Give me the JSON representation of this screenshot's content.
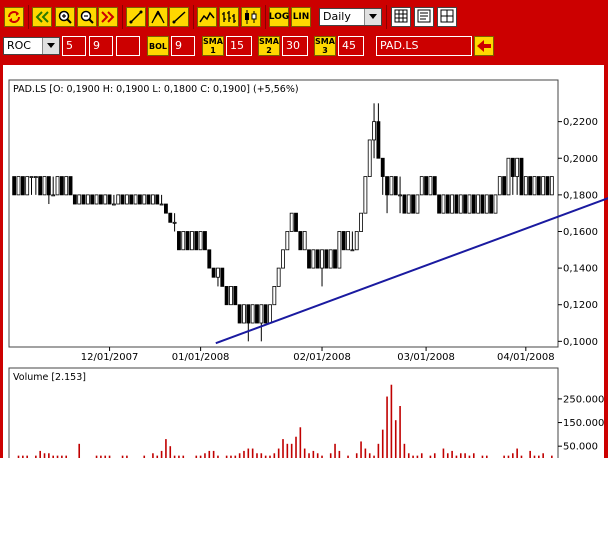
{
  "toolbar": {
    "period": "Daily",
    "indicator": "ROC",
    "roc_param1": "5",
    "roc_param2": "9",
    "roc_param3": "",
    "bol_label": "BOL",
    "bol_param": "9",
    "sma1_label": "SMA 1",
    "sma1_value": "15",
    "sma2_label": "SMA 2",
    "sma2_value": "30",
    "sma3_label": "SMA 3",
    "sma3_value": "45",
    "log_label": "LOG",
    "lin_label": "LIN",
    "symbol": "PAD.LS",
    "icons": [
      "refresh-icon",
      "scroll-left-icon",
      "zoom-in-icon",
      "zoom-out-icon",
      "scroll-right-icon",
      "trendline-icon",
      "fibonacci-icon",
      "line-draw-icon",
      "line-chart-icon",
      "ohlc-bars-icon",
      "candlestick-icon",
      "grid-icon",
      "table-icon",
      "layout-icon",
      "back-arrow-icon"
    ]
  },
  "colors": {
    "toolbar": "#cc0000",
    "button": "#ffd800",
    "trendline": "#1a1aa0",
    "volume": "#c00000"
  },
  "chart_data": [
    {
      "type": "candlestick",
      "title": "PAD.LS [O: 0,1900  H: 0,1900  L: 0,1800  C: 0,1900] (+5,56%)",
      "x_tick_labels": [
        "12/01/2007",
        "01/01/2008",
        "02/01/2008",
        "03/01/2008",
        "04/01/2008"
      ],
      "y_tick_labels": [
        "0,2200",
        "0,2000",
        "0,1800",
        "0,1600",
        "0,1400",
        "0,1200",
        "0,1000"
      ],
      "ylim": [
        0.098,
        0.234
      ],
      "grid": false,
      "trendline": {
        "start": [
          46.5,
          0.099
        ],
        "end": [
          147,
          0.187
        ]
      },
      "series": [
        {
          "values": [
            [
              0.19,
              0.19,
              0.18,
              0.18
            ],
            [
              0.18,
              0.19,
              0.18,
              0.19
            ],
            [
              0.19,
              0.19,
              0.18,
              0.18
            ],
            [
              0.18,
              0.19,
              0.18,
              0.19
            ],
            [
              0.19,
              0.19,
              0.18,
              0.19
            ],
            [
              0.19,
              0.19,
              0.18,
              0.19
            ],
            [
              0.19,
              0.19,
              0.18,
              0.18
            ],
            [
              0.18,
              0.19,
              0.18,
              0.19
            ],
            [
              0.19,
              0.19,
              0.175,
              0.18
            ],
            [
              0.18,
              0.19,
              0.18,
              0.18
            ],
            [
              0.18,
              0.19,
              0.18,
              0.19
            ],
            [
              0.19,
              0.19,
              0.18,
              0.18
            ],
            [
              0.18,
              0.19,
              0.18,
              0.19
            ],
            [
              0.19,
              0.19,
              0.18,
              0.18
            ],
            [
              0.18,
              0.18,
              0.175,
              0.175
            ],
            [
              0.175,
              0.18,
              0.175,
              0.18
            ],
            [
              0.18,
              0.18,
              0.175,
              0.175
            ],
            [
              0.175,
              0.18,
              0.175,
              0.18
            ],
            [
              0.18,
              0.18,
              0.175,
              0.175
            ],
            [
              0.175,
              0.18,
              0.175,
              0.18
            ],
            [
              0.18,
              0.18,
              0.175,
              0.175
            ],
            [
              0.175,
              0.18,
              0.175,
              0.18
            ],
            [
              0.18,
              0.18,
              0.175,
              0.175
            ],
            [
              0.175,
              0.18,
              0.175,
              0.175
            ],
            [
              0.175,
              0.18,
              0.175,
              0.18
            ],
            [
              0.18,
              0.18,
              0.175,
              0.175
            ],
            [
              0.175,
              0.18,
              0.175,
              0.18
            ],
            [
              0.18,
              0.18,
              0.175,
              0.175
            ],
            [
              0.175,
              0.18,
              0.175,
              0.18
            ],
            [
              0.18,
              0.18,
              0.175,
              0.175
            ],
            [
              0.175,
              0.18,
              0.175,
              0.18
            ],
            [
              0.18,
              0.18,
              0.175,
              0.175
            ],
            [
              0.175,
              0.18,
              0.175,
              0.18
            ],
            [
              0.18,
              0.18,
              0.175,
              0.175
            ],
            [
              0.175,
              0.18,
              0.175,
              0.175
            ],
            [
              0.175,
              0.175,
              0.17,
              0.17
            ],
            [
              0.17,
              0.17,
              0.165,
              0.165
            ],
            [
              0.165,
              0.17,
              0.16,
              0.165
            ],
            [
              0.16,
              0.16,
              0.15,
              0.15
            ],
            [
              0.15,
              0.16,
              0.15,
              0.16
            ],
            [
              0.16,
              0.16,
              0.15,
              0.15
            ],
            [
              0.15,
              0.16,
              0.15,
              0.16
            ],
            [
              0.16,
              0.16,
              0.15,
              0.15
            ],
            [
              0.15,
              0.16,
              0.15,
              0.16
            ],
            [
              0.16,
              0.16,
              0.15,
              0.15
            ],
            [
              0.15,
              0.15,
              0.14,
              0.14
            ],
            [
              0.14,
              0.14,
              0.135,
              0.135
            ],
            [
              0.135,
              0.14,
              0.13,
              0.14
            ],
            [
              0.14,
              0.14,
              0.13,
              0.13
            ],
            [
              0.13,
              0.13,
              0.12,
              0.12
            ],
            [
              0.12,
              0.13,
              0.12,
              0.13
            ],
            [
              0.13,
              0.13,
              0.12,
              0.12
            ],
            [
              0.12,
              0.12,
              0.11,
              0.11
            ],
            [
              0.11,
              0.12,
              0.11,
              0.12
            ],
            [
              0.12,
              0.12,
              0.1,
              0.11
            ],
            [
              0.11,
              0.12,
              0.11,
              0.12
            ],
            [
              0.12,
              0.12,
              0.11,
              0.11
            ],
            [
              0.11,
              0.12,
              0.1,
              0.12
            ],
            [
              0.12,
              0.12,
              0.11,
              0.11
            ],
            [
              0.11,
              0.12,
              0.11,
              0.12
            ],
            [
              0.12,
              0.13,
              0.12,
              0.13
            ],
            [
              0.13,
              0.14,
              0.13,
              0.14
            ],
            [
              0.14,
              0.15,
              0.14,
              0.15
            ],
            [
              0.15,
              0.16,
              0.15,
              0.16
            ],
            [
              0.16,
              0.17,
              0.16,
              0.17
            ],
            [
              0.17,
              0.17,
              0.16,
              0.16
            ],
            [
              0.16,
              0.16,
              0.15,
              0.15
            ],
            [
              0.15,
              0.16,
              0.15,
              0.16
            ],
            [
              0.15,
              0.15,
              0.14,
              0.14
            ],
            [
              0.14,
              0.15,
              0.14,
              0.15
            ],
            [
              0.15,
              0.15,
              0.14,
              0.14
            ],
            [
              0.14,
              0.15,
              0.13,
              0.15
            ],
            [
              0.15,
              0.15,
              0.14,
              0.14
            ],
            [
              0.14,
              0.15,
              0.14,
              0.15
            ],
            [
              0.15,
              0.15,
              0.14,
              0.14
            ],
            [
              0.14,
              0.16,
              0.14,
              0.16
            ],
            [
              0.16,
              0.16,
              0.15,
              0.15
            ],
            [
              0.15,
              0.16,
              0.15,
              0.16
            ],
            [
              0.15,
              0.16,
              0.15,
              0.15
            ],
            [
              0.15,
              0.16,
              0.15,
              0.16
            ],
            [
              0.16,
              0.17,
              0.16,
              0.17
            ],
            [
              0.17,
              0.19,
              0.17,
              0.19
            ],
            [
              0.19,
              0.21,
              0.19,
              0.21
            ],
            [
              0.21,
              0.23,
              0.2,
              0.22
            ],
            [
              0.22,
              0.23,
              0.2,
              0.2
            ],
            [
              0.2,
              0.2,
              0.18,
              0.19
            ],
            [
              0.19,
              0.19,
              0.17,
              0.18
            ],
            [
              0.18,
              0.19,
              0.18,
              0.19
            ],
            [
              0.19,
              0.19,
              0.18,
              0.18
            ],
            [
              0.18,
              0.19,
              0.17,
              0.18
            ],
            [
              0.18,
              0.18,
              0.17,
              0.17
            ],
            [
              0.17,
              0.18,
              0.17,
              0.18
            ],
            [
              0.18,
              0.18,
              0.17,
              0.17
            ],
            [
              0.17,
              0.18,
              0.17,
              0.18
            ],
            [
              0.18,
              0.19,
              0.18,
              0.19
            ],
            [
              0.19,
              0.19,
              0.18,
              0.18
            ],
            [
              0.18,
              0.19,
              0.18,
              0.19
            ],
            [
              0.19,
              0.19,
              0.18,
              0.18
            ],
            [
              0.18,
              0.18,
              0.17,
              0.17
            ],
            [
              0.17,
              0.18,
              0.17,
              0.18
            ],
            [
              0.18,
              0.18,
              0.17,
              0.17
            ],
            [
              0.17,
              0.18,
              0.17,
              0.18
            ],
            [
              0.18,
              0.18,
              0.17,
              0.17
            ],
            [
              0.17,
              0.18,
              0.17,
              0.18
            ],
            [
              0.18,
              0.18,
              0.17,
              0.17
            ],
            [
              0.17,
              0.18,
              0.17,
              0.18
            ],
            [
              0.18,
              0.18,
              0.17,
              0.17
            ],
            [
              0.17,
              0.18,
              0.17,
              0.18
            ],
            [
              0.18,
              0.18,
              0.17,
              0.17
            ],
            [
              0.17,
              0.18,
              0.17,
              0.18
            ],
            [
              0.18,
              0.18,
              0.17,
              0.17
            ],
            [
              0.17,
              0.18,
              0.17,
              0.18
            ],
            [
              0.18,
              0.19,
              0.18,
              0.19
            ],
            [
              0.19,
              0.19,
              0.18,
              0.18
            ],
            [
              0.18,
              0.2,
              0.18,
              0.2
            ],
            [
              0.2,
              0.2,
              0.18,
              0.19
            ],
            [
              0.19,
              0.2,
              0.18,
              0.2
            ],
            [
              0.2,
              0.2,
              0.18,
              0.18
            ],
            [
              0.18,
              0.19,
              0.18,
              0.19
            ],
            [
              0.19,
              0.19,
              0.18,
              0.18
            ],
            [
              0.18,
              0.19,
              0.18,
              0.19
            ],
            [
              0.19,
              0.19,
              0.18,
              0.18
            ],
            [
              0.18,
              0.19,
              0.18,
              0.19
            ],
            [
              0.19,
              0.19,
              0.18,
              0.18
            ],
            [
              0.18,
              0.19,
              0.18,
              0.19
            ]
          ]
        }
      ]
    },
    {
      "type": "bar",
      "title": "Volume [2.153]",
      "y_tick_labels": [
        "250.000",
        "150.000",
        "50.000"
      ],
      "ylim": [
        0,
        330000
      ],
      "series": [
        {
          "name": "Volume",
          "values": [
            0,
            10000,
            10000,
            10000,
            0,
            10000,
            30000,
            20000,
            20000,
            10000,
            10000,
            10000,
            10000,
            0,
            0,
            60000,
            0,
            0,
            0,
            10000,
            10000,
            10000,
            10000,
            0,
            0,
            10000,
            10000,
            0,
            0,
            0,
            10000,
            0,
            20000,
            10000,
            30000,
            80000,
            50000,
            10000,
            10000,
            10000,
            0,
            0,
            10000,
            10000,
            20000,
            30000,
            30000,
            10000,
            0,
            10000,
            10000,
            10000,
            20000,
            30000,
            40000,
            40000,
            20000,
            20000,
            10000,
            10000,
            20000,
            40000,
            80000,
            60000,
            60000,
            90000,
            130000,
            40000,
            20000,
            30000,
            20000,
            10000,
            0,
            20000,
            60000,
            30000,
            0,
            10000,
            0,
            20000,
            70000,
            40000,
            20000,
            10000,
            60000,
            120000,
            260000,
            310000,
            160000,
            220000,
            60000,
            20000,
            10000,
            10000,
            20000,
            0,
            10000,
            20000,
            0,
            40000,
            20000,
            30000,
            10000,
            20000,
            20000,
            10000,
            20000,
            0,
            10000,
            10000,
            0,
            0,
            0,
            10000,
            10000,
            20000,
            40000,
            10000,
            0,
            30000,
            10000,
            10000,
            20000,
            0,
            10000
          ]
        }
      ]
    }
  ]
}
